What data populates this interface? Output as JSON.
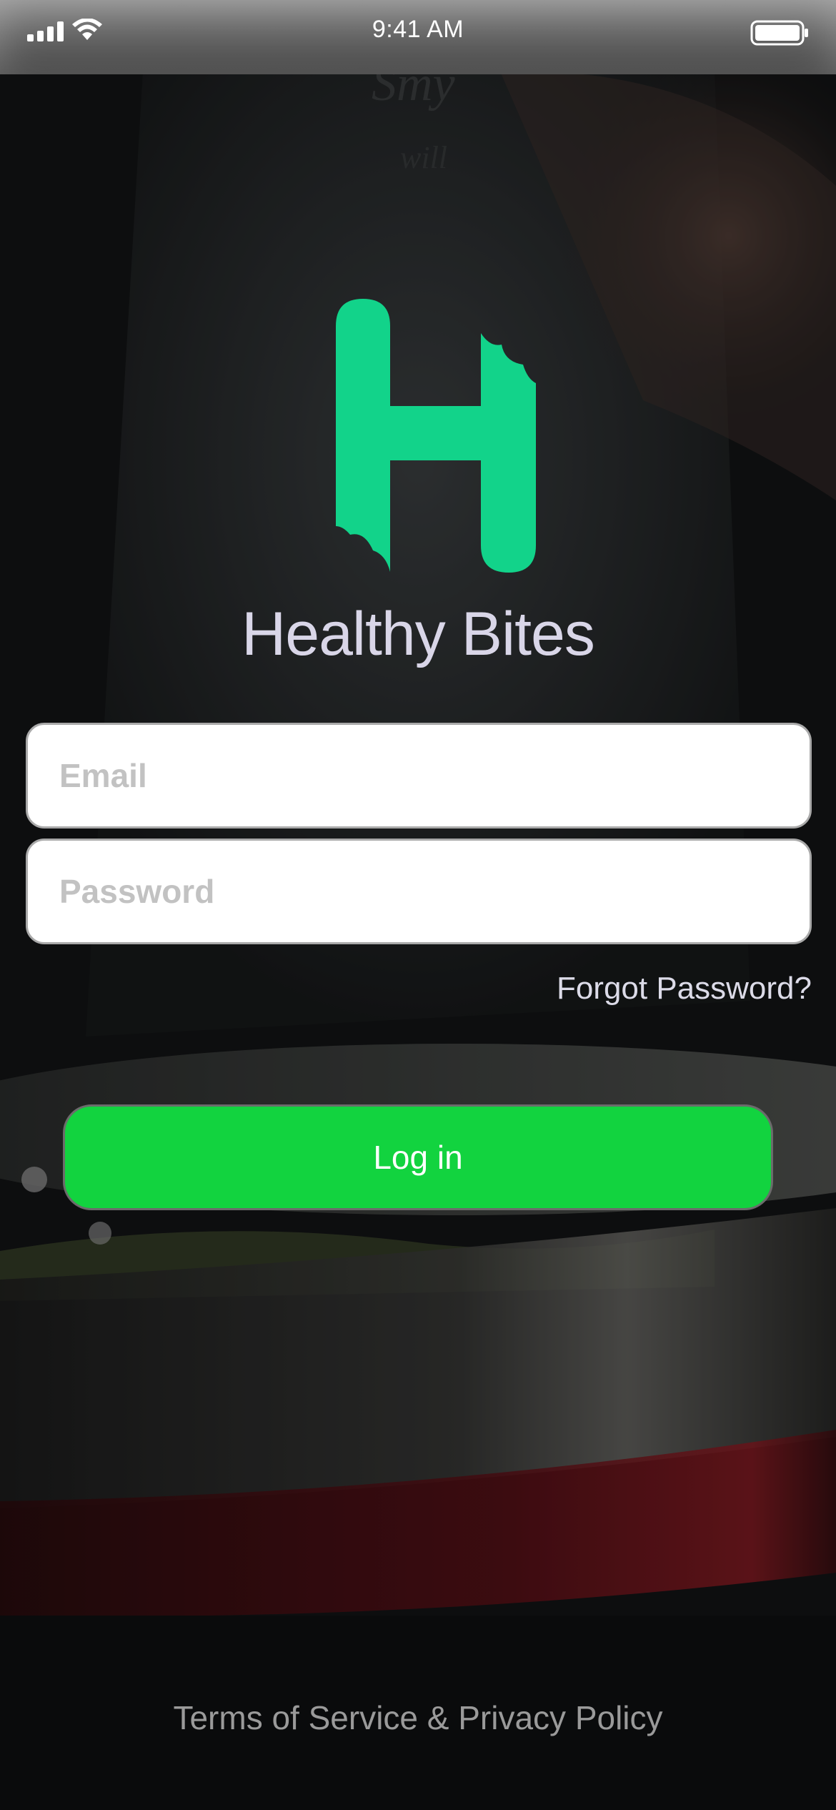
{
  "status_bar": {
    "time": "9:41 AM",
    "icons": [
      "cellular-signal-icon",
      "wifi-icon",
      "battery-icon"
    ]
  },
  "brand": {
    "logo_icon": "healthy-bites-h-logo",
    "title": "Healthy Bites",
    "accent_color": "#12d38a"
  },
  "form": {
    "email_placeholder": "Email",
    "email_value": "",
    "password_placeholder": "Password",
    "password_value": "",
    "forgot_label": "Forgot Password?",
    "login_label": "Log in",
    "login_color": "#12d33f"
  },
  "footer": {
    "legal_label": "Terms of Service & Privacy Policy"
  }
}
